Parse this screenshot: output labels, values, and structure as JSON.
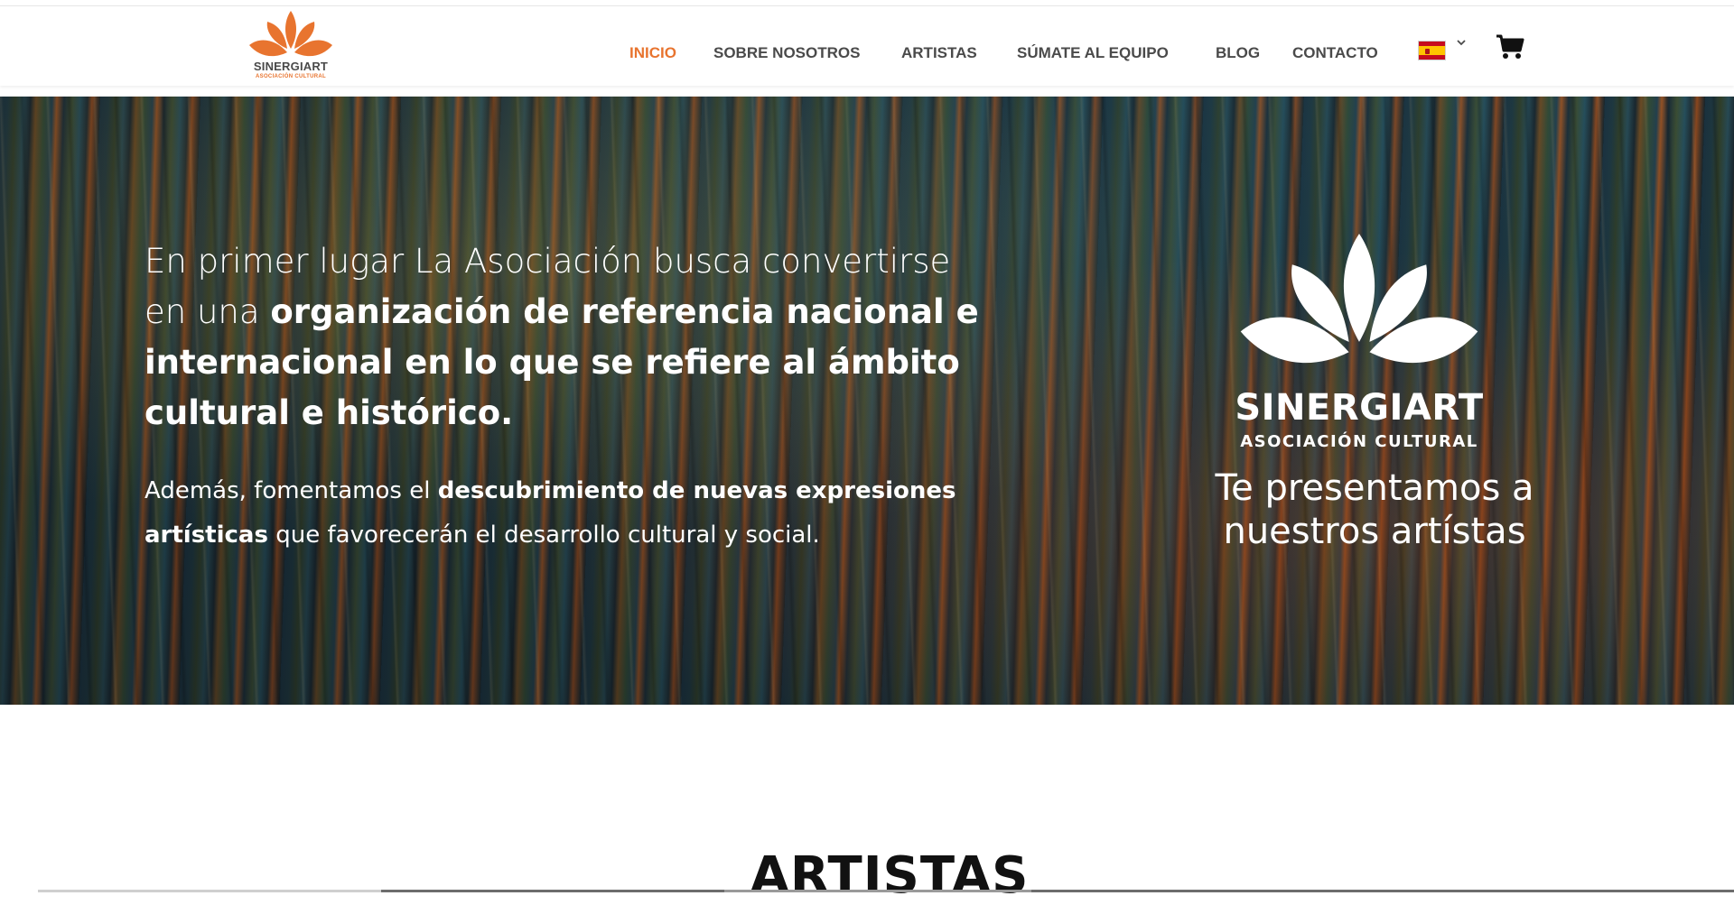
{
  "brand": {
    "name": "SINERGIART",
    "subtitle": "ASOCIACIÓN CULTURAL",
    "accent_color": "#e8742f"
  },
  "nav": {
    "items": [
      {
        "label": "INICIO",
        "active": true
      },
      {
        "label": "SOBRE NOSOTROS",
        "active": false
      },
      {
        "label": "ARTISTAS",
        "active": false
      },
      {
        "label": "SÚMATE AL EQUIPO",
        "active": false
      },
      {
        "label": "BLOG",
        "active": false
      },
      {
        "label": "CONTACTO",
        "active": false
      }
    ],
    "language_icon": "spain-flag-icon",
    "language_toggle_icon": "chevron-down-icon",
    "cart_icon": "shopping-cart-icon"
  },
  "hero": {
    "paragraph1": {
      "plain1": "En primer lugar La Asociación busca convertirse en una ",
      "bold1": "organización de referencia nacional e internacional en lo que se refiere al ámbito cultural e histórico."
    },
    "paragraph2": {
      "plain1": "Además, fomentamos el ",
      "bold1": "descubrimiento de nuevas expresiones artísticas",
      "plain2": " que favorecerán el desarrollo cultural y social."
    },
    "logo_name": "SINERGIART",
    "logo_subtitle": "ASOCIACIÓN CULTURAL",
    "tagline": "Te presentamos a nuestros artístas"
  },
  "section": {
    "title": "ARTISTAS"
  }
}
